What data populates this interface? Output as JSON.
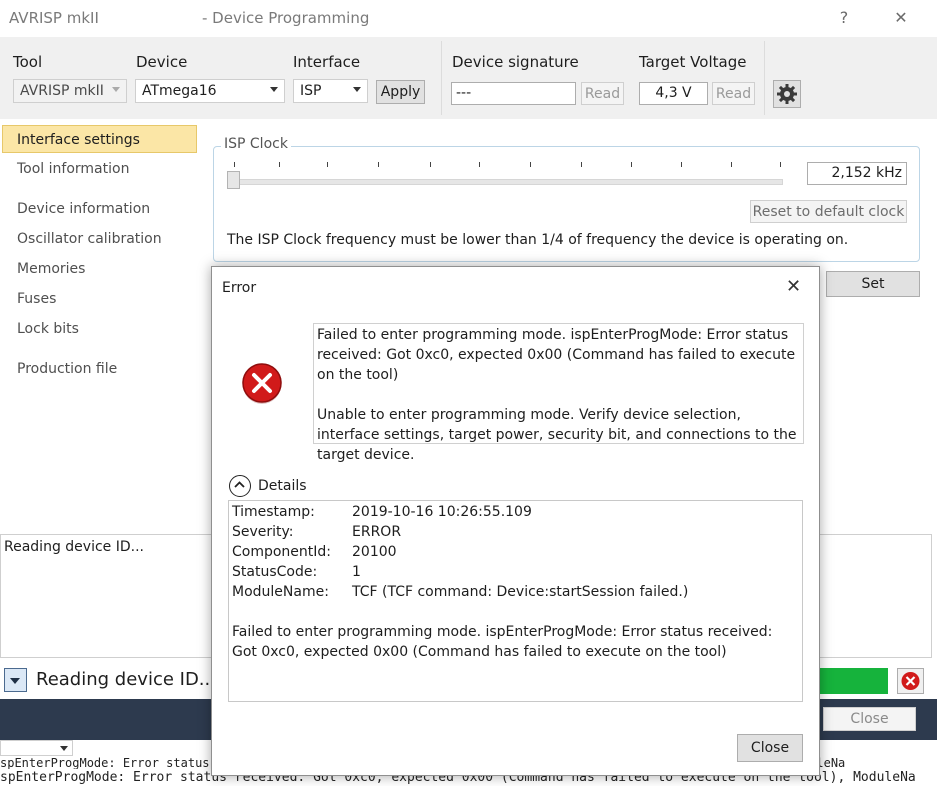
{
  "window": {
    "tool_name": "AVRISP mkII",
    "title": "- Device Programming",
    "help_glyph": "?",
    "close_glyph": "✕"
  },
  "toolbar": {
    "tool_label": "Tool",
    "tool_value": "AVRISP mkII",
    "device_label": "Device",
    "device_value": "ATmega16",
    "interface_label": "Interface",
    "interface_value": "ISP",
    "apply_label": "Apply",
    "signature_label": "Device signature",
    "signature_value": "---",
    "signature_read_label": "Read",
    "voltage_label": "Target Voltage",
    "voltage_value": "4,3 V",
    "voltage_read_label": "Read",
    "settings_icon": "gear-icon"
  },
  "sidebar": {
    "items": [
      {
        "label": "Interface settings",
        "selected": true
      },
      {
        "label": "Tool information"
      },
      {
        "label": "Device information"
      },
      {
        "label": "Oscillator calibration"
      },
      {
        "label": "Memories"
      },
      {
        "label": "Fuses"
      },
      {
        "label": "Lock bits"
      },
      {
        "label": "Production file"
      }
    ]
  },
  "isp": {
    "group_label": "ISP Clock",
    "clock_value": "2,152 kHz",
    "reset_label": "Reset to default clock",
    "note": "The ISP Clock frequency must be lower than 1/4 of frequency the device is operating on.",
    "slider_level": 0,
    "set_label": "Set"
  },
  "output": {
    "log_text": "Reading device ID...",
    "status_text": "Reading device ID...",
    "close_label": "Close",
    "progress_color": "#16b33c"
  },
  "console": {
    "line1": "spEnterProgMode: Error status received: Got 0xc0, expected 0x00 (Command has failed to execute on the tool), ModuleNa",
    "line2_partial": "spEnterProgMode: Error status received: Got 0xc0, expected 0x00 (Command has failed to execute on the tool), ModuleNa"
  },
  "dialog": {
    "title": "Error",
    "close_glyph": "✕",
    "message_p1": "Failed to enter programming mode. ispEnterProgMode: Error status received: Got 0xc0, expected 0x00 (Command has failed to execute on the tool)",
    "message_p2": "Unable to enter programming mode. Verify device selection, interface settings, target power, security bit, and connections to the target device.",
    "details_label": "Details",
    "details": [
      {
        "key": "Timestamp:",
        "value": "2019-10-16 10:26:55.109"
      },
      {
        "key": "Severity:",
        "value": "ERROR"
      },
      {
        "key": "ComponentId:",
        "value": "20100"
      },
      {
        "key": "StatusCode:",
        "value": "1"
      },
      {
        "key": "ModuleName:",
        "value": "TCF (TCF command: Device:startSession failed.)"
      }
    ],
    "details_message": "Failed to enter programming mode. ispEnterProgMode: Error status received: Got 0xc0, expected 0x00 (Command has failed to execute on the tool)",
    "close_label": "Close",
    "error_color": "#d11a1a"
  }
}
